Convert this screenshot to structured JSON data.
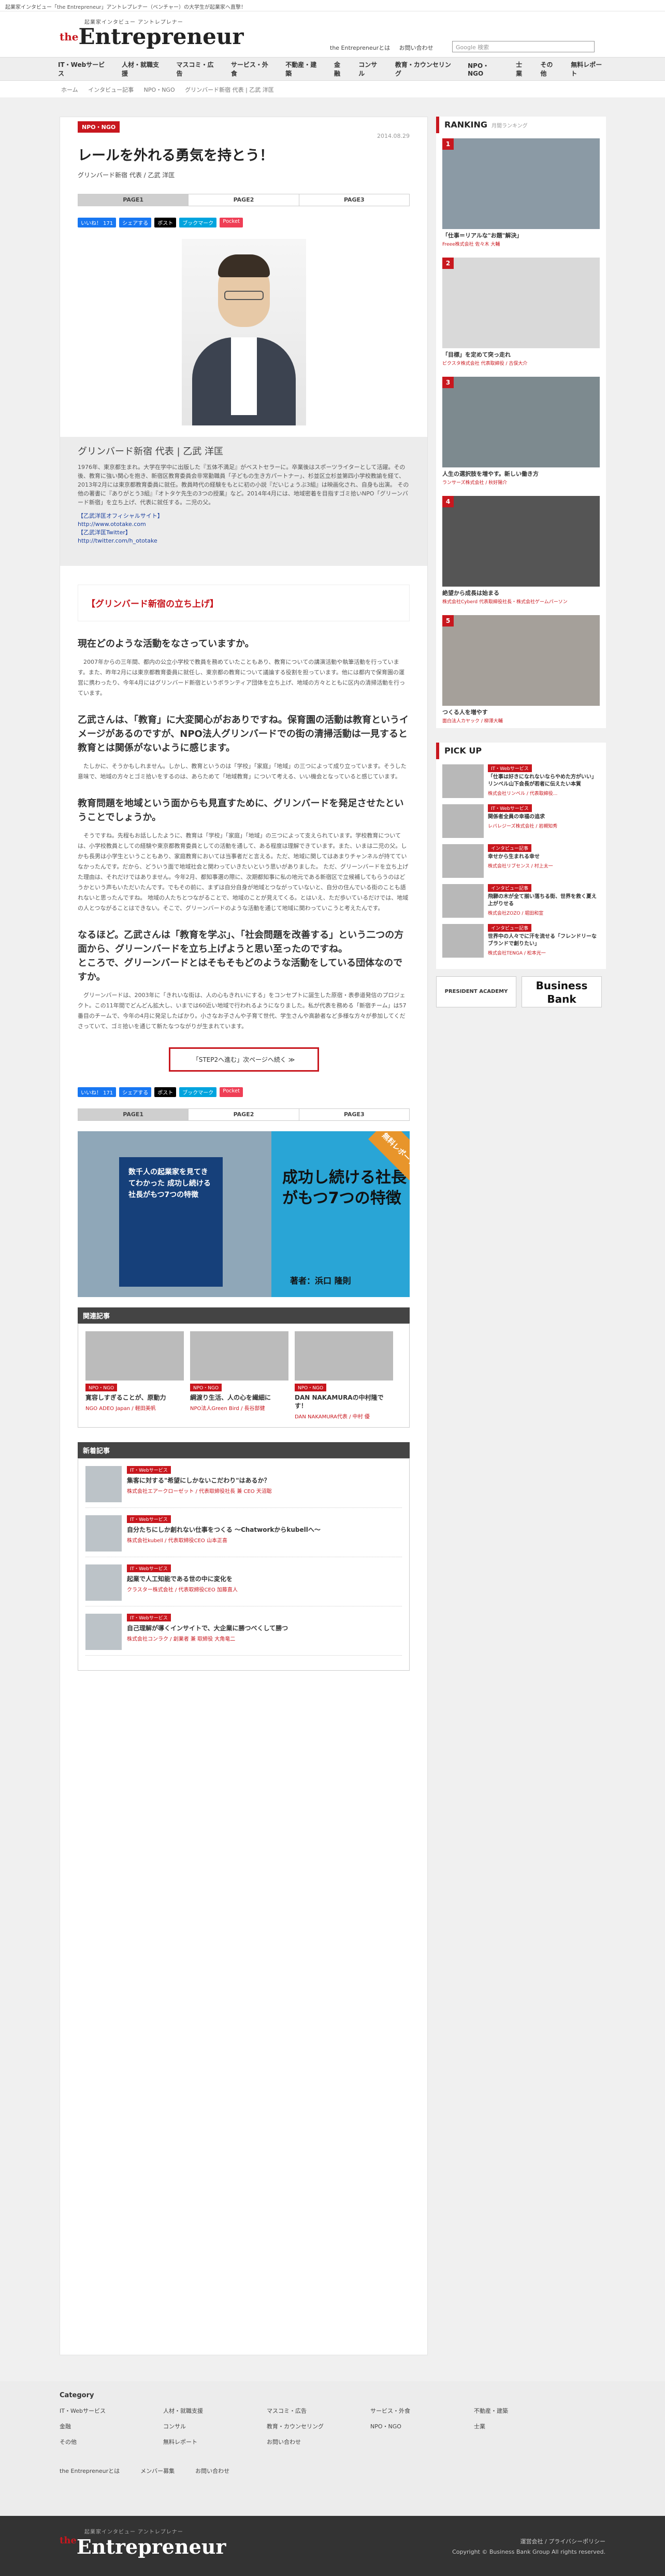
{
  "topstrip": "起業家インタビュー「the Entrepreneur」アントレプレナー（ベンチャー）の大学生が起業家へ直撃！",
  "logo": {
    "sub": "起業家インタビュー アントレプレナー",
    "main": "Entrepreneur",
    "the": "the"
  },
  "header_links": [
    "the Entrepreneurとは",
    "お問い合わせ"
  ],
  "search": {
    "placeholder": "Google 検索"
  },
  "nav": [
    "IT・Webサービス",
    "人材・就職支援",
    "マスコミ・広告",
    "サービス・外食",
    "不動産・建築",
    "金融",
    "コンサル",
    "教育・カウンセリング",
    "NPO・NGO",
    "士業",
    "その他",
    "無料レポート"
  ],
  "breadcrumb": [
    "ホーム",
    "インタビュー記事",
    "NPO・NGO",
    "グリンバード新宿 代表 | 乙武 洋匡"
  ],
  "article": {
    "category": "NPO・NGO",
    "date": "2014.08.29",
    "title": "レールを外れる勇気を持とう！",
    "byline": "グリンバード新宿 代表 / 乙武 洋匡",
    "pager": [
      "PAGE1",
      "PAGE2",
      "PAGE3"
    ],
    "share": [
      "いいね！ 171",
      "シェアする",
      "ポスト",
      "ブックマーク",
      "Pocket"
    ],
    "profile_name": "グリンバード新宿 代表 | 乙武 洋匡",
    "profile_text": "1976年、東京都生まれ。大学在学中に出版した『五体不満足』がベストセラーに。卒業後はスポーツライターとして活躍。その後、教育に強い関心を抱き、新宿区教育委員会非常勤職員「子どもの生き方パートナー」、杉並区立杉並第四小学校教諭を経て、2013年2月には東京都教育委員に就任。教員時代の経験をもとに初の小説『だいじょうぶ3組』は映画化され、自身も出演。 その他の著書に『ありがとう3組』『オトタケ先生の3つの授業』など。2014年4月には、地域密着を目指すゴミ拾いNPO「グリーンバード新宿」を立ち上げ、代表に就任する。二児の父。",
    "links": [
      "【乙武洋匡オフィシャルサイト】",
      "http://www.ototake.com",
      "【乙武洋匡Twitter】",
      "http://twitter.com/h_ototake"
    ],
    "section_title": "【グリンバード新宿の立ち上げ】",
    "qa": [
      {
        "q": "現在どのような活動をなさっていますか。",
        "a": "2007年からの三年間、都内の公立小学校で教員を務めていたこともあり、教育についての講演活動や執筆活動を行っています。また、昨年2月には東京都教育委員に就任し、東京都の教育について議論する役割を担っています。他には都内で保育園の運営に携わったり、今年4月にはグリンバード新宿というボランティア団体を立ち上げ、地域の方々とともに区内の清掃活動を行っています。"
      },
      {
        "q": "乙武さんは、「教育」に大変関心がおありですね。保育園の活動は教育というイメージがあるのですが、NPO法人グリンバードでの街の清掃活動は一見すると教育とは関係がないように感じます。",
        "a": "たしかに、そうかもしれません。しかし、教育というのは「学校」「家庭」「地域」の三つによって成り立っています。そうした意味で、地域の方々とゴミ拾いをするのは、あらためて「地域教育」について考える、いい機会となっていると感じています。"
      },
      {
        "q": "教育問題を地域という面からも見直すために、グリンバードを発足させたということでしょうか。",
        "a": "そうですね。先程もお話ししたように、教育は「学校」「家庭」「地域」の三つによって支えられています。学校教育については、小学校教員としての経験や東京都教育委員としての活動を通して、ある程度は理解できています。また、いまは二児の父。しかも長男は小学生ということもあり、家庭教育においては当事者だと言える。ただ、地域に関してはあまりチャンネルが持てていなかったんです。だから、どういう面で地域社会と関わっていきたいという思いがありました。\nただ、グリーンバードを立ち上げた理由は、それだけではありません。今年2月、都知事選の際に、次期都知事に私の地元である新宿区で立候補してもらうのはどうかという声もいただいたんです。でもその前に、まずは自分自身が地域とつながっていないと、自分の住んでいる街のことも語れないと思ったんですね。\n地域の人たちとつながることで、地域のことが見えてくる。とはいえ、ただ歩いているだけでは、地域の人とつながることはできない。そこで、グリーンバードのような活動を通じて地域に関わっていこうと考えたんです。"
      },
      {
        "q": "なるほど。乙武さんは「教育を学ぶ」、「社会問題を改善する」という二つの方面から、グリーンバードを立ち上げようと思い至ったのですね。\nところで、グリーンバードとはそもそもどのような活動をしている団体なのですか。",
        "a": "グリーンバードは、2003年に「きれいな街は、人の心もきれいにする」をコンセプトに誕生した原宿・表参道発信のプロジェクト。この11年間でどんどん拡大し、いまでは60近い地域で行われるようになりました。私が代表を務める「新宿チーム」は57番目のチームで、今年の4月に発足したばかり。小さなお子さんや子育て世代、学生さんや高齢者など多様な方々が参加してくださっていて、ゴミ拾いを通じて新たなつながりが生まれています。"
      }
    ],
    "next_label": "「STEP2へ進む」次ページへ続く ≫"
  },
  "banner": {
    "book": "数千人の起業家を見てきてわかった 成功し続ける社長がもつ7つの特徴",
    "right": "成功し続ける社長がもつ7つの特徴",
    "ribbon": "無料レポート",
    "author": "著者：浜口 隆則"
  },
  "related": {
    "title": "関連記事",
    "items": [
      {
        "badge": "NPO・NGO",
        "title": "寛容しすぎることが、原動力",
        "co": "NGO ADEO Japan / 軽田美帆"
      },
      {
        "badge": "NPO・NGO",
        "title": "綱渡り生活、人の心を繊細に",
        "co": "NPO法人Green Bird / 長谷部健"
      },
      {
        "badge": "NPO・NGO",
        "title": "DAN NAKAMURAの中村隆です！",
        "co": "DAN NAKAMURA代表 / 中村 優"
      }
    ]
  },
  "news": {
    "title": "新着記事",
    "items": [
      {
        "badge": "IT・Webサービス",
        "title": "集客に対する\"希望にしかないこだわり\"はあるか？",
        "co": "株式会社エアークローゼット / 代表取締役社長 兼 CEO 天沼聡"
      },
      {
        "badge": "IT・Webサービス",
        "title": "自分たちにしか創れない仕事をつくる 〜Chatworkからkubellへ〜",
        "co": "株式会社kubell / 代表取締役CEO 山本正喜"
      },
      {
        "badge": "IT・Webサービス",
        "title": "起業で人工知能である世の中に変化を",
        "co": "クラスター株式会社 / 代表取締役CEO 加藤直人"
      },
      {
        "badge": "IT・Webサービス",
        "title": "自己理解が導くインサイトで、大企業に勝つべくして勝つ",
        "co": "株式会社コンラク / 創業者 兼 取締役 大角竜二"
      }
    ]
  },
  "ranking": {
    "title": "RANKING",
    "sub": "月間ランキング",
    "items": [
      {
        "num": "1",
        "title": "「仕事＝リアルな\"お題\"解決」",
        "co": "Freee株式会社 佐々木 大輔"
      },
      {
        "num": "2",
        "title": "「目標」を定めて突っ走れ",
        "co": "ピクスタ株式会社 代表取締役 / 古俣大介"
      },
      {
        "num": "3",
        "title": "人生の選択肢を増やす。新しい働き方",
        "co": "ランサーズ株式会社 / 秋好陽介"
      },
      {
        "num": "4",
        "title": "絶望から成長は始まる",
        "co": "株式会社Cyberd 代表取締役社長・株式会社ゲームパーソン"
      },
      {
        "num": "5",
        "title": "つくる人を増やす",
        "co": "面白法人カヤック / 柳澤大輔"
      }
    ]
  },
  "pickup": {
    "title": "PICK UP",
    "items": [
      {
        "badge": "IT・Webサービス",
        "title": "「仕事は好きになれないならやめた方がいい」リンベル山下会長が若者に伝えたい本質",
        "co": "株式会社リンベル / 代表取締役..."
      },
      {
        "badge": "IT・Webサービス",
        "title": "関係者全員の幸福の追求",
        "co": "レバレジーズ株式会社 / 岩槻知秀"
      },
      {
        "badge": "インタビュー記事",
        "title": "幸せから生まれる幸せ",
        "co": "株式会社リブセンス / 村上太一"
      },
      {
        "badge": "インタビュー記事",
        "title": "飛騨の木が全て揃い落ちる街、世界を救く夏え上がりせる",
        "co": "株式会社ZOZO / 堀田和宣"
      },
      {
        "badge": "インタビュー記事",
        "title": "世界中の人々でに汗を流せる「フレンドリーなブランドで創りたい」",
        "co": "株式会社TENGA / 松本光一"
      }
    ]
  },
  "side_banners": [
    "PRESIDENT ACADEMY",
    "Business Bank"
  ],
  "footer": {
    "category": "Category",
    "cols": [
      "IT・Webサービス",
      "人材・就職支援",
      "マスコミ・広告",
      "サービス・外食",
      "不動産・建築",
      "金融",
      "コンサル",
      "教育・カウンセリング",
      "NPO・NGO",
      "士業",
      "その他",
      "無料レポート",
      "お問い合わせ"
    ],
    "bottom": [
      "the Entrepreneurとは",
      "メンバー募集",
      "お問い合わせ"
    ],
    "links": "運営会社 / プライバシーポリシー",
    "copy": "Copyright © Business Bank Group All rights reserved."
  },
  "colors": {
    "accent": "#c8171e",
    "nav_bg": "#eeeeee",
    "footer_dark": "#333333"
  }
}
